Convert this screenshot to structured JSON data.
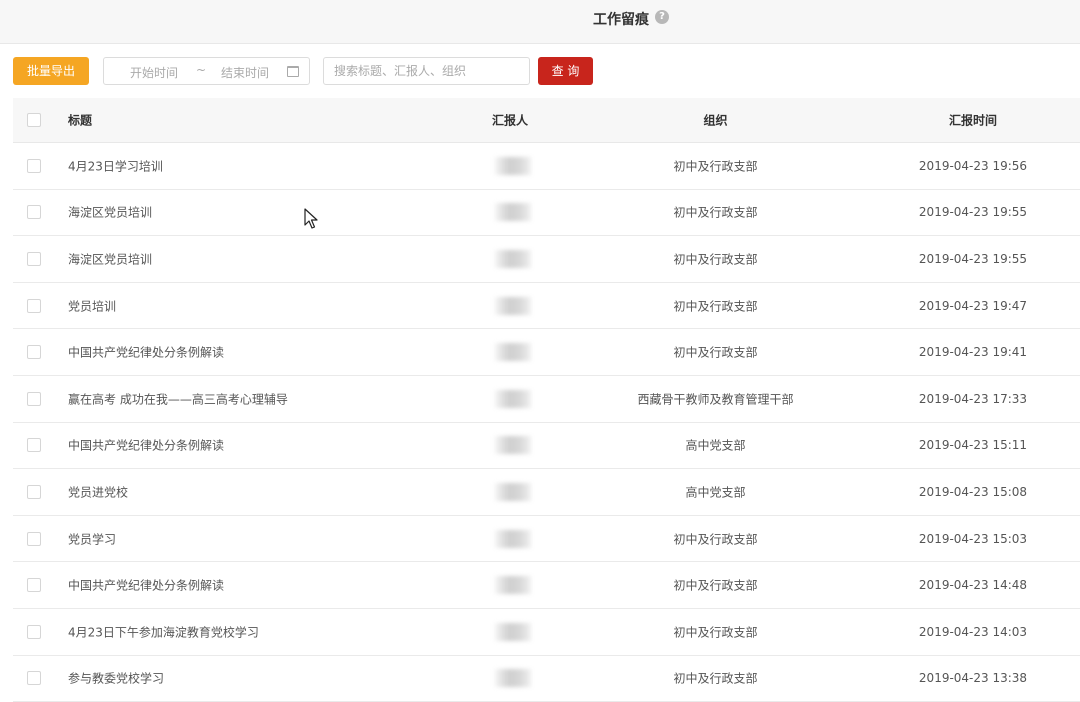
{
  "header": {
    "title": "工作留痕",
    "help_icon": "?"
  },
  "toolbar": {
    "export_label": "批量导出",
    "date_start": "开始时间",
    "date_sep": "~",
    "date_end": "结束时间",
    "search_placeholder": "搜索标题、汇报人、组织",
    "query_label": "查 询"
  },
  "table": {
    "columns": {
      "title": "标题",
      "reporter": "汇报人",
      "org": "组织",
      "time": "汇报时间"
    },
    "rows": [
      {
        "title": "4月23日学习培训",
        "org": "初中及行政支部",
        "time": "2019-04-23 19:56"
      },
      {
        "title": "海淀区党员培训",
        "org": "初中及行政支部",
        "time": "2019-04-23 19:55"
      },
      {
        "title": "海淀区党员培训",
        "org": "初中及行政支部",
        "time": "2019-04-23 19:55"
      },
      {
        "title": "党员培训",
        "org": "初中及行政支部",
        "time": "2019-04-23 19:47"
      },
      {
        "title": "中国共产党纪律处分条例解读",
        "org": "初中及行政支部",
        "time": "2019-04-23 19:41"
      },
      {
        "title": "赢在高考 成功在我——高三高考心理辅导",
        "org": "西藏骨干教师及教育管理干部",
        "time": "2019-04-23 17:33"
      },
      {
        "title": "中国共产党纪律处分条例解读",
        "org": "高中党支部",
        "time": "2019-04-23 15:11"
      },
      {
        "title": "党员进党校",
        "org": "高中党支部",
        "time": "2019-04-23 15:08"
      },
      {
        "title": "党员学习",
        "org": "初中及行政支部",
        "time": "2019-04-23 15:03"
      },
      {
        "title": "中国共产党纪律处分条例解读",
        "org": "初中及行政支部",
        "time": "2019-04-23 14:48"
      },
      {
        "title": "4月23日下午参加海淀教育党校学习",
        "org": "初中及行政支部",
        "time": "2019-04-23 14:03"
      },
      {
        "title": "参与教委党校学习",
        "org": "初中及行政支部",
        "time": "2019-04-23 13:38"
      }
    ]
  },
  "colors": {
    "export": "#f5a623",
    "query": "#c8251c"
  }
}
